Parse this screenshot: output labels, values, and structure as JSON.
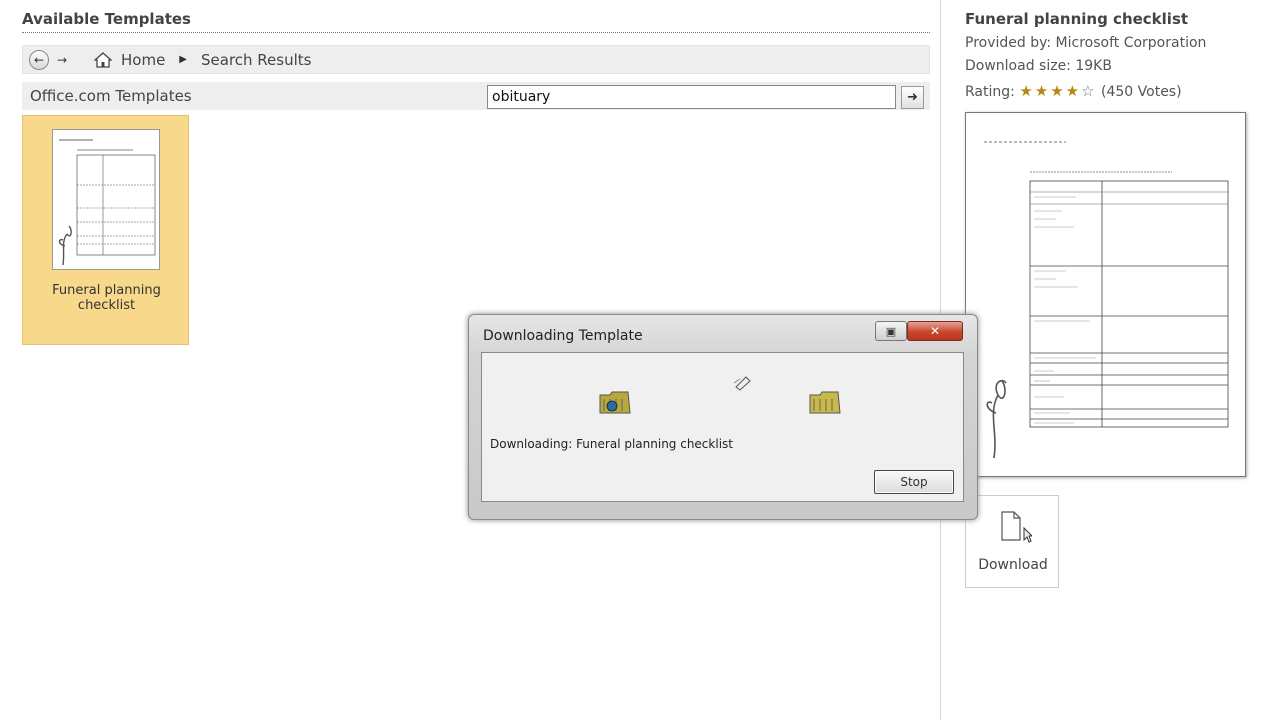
{
  "main": {
    "heading": "Available Templates",
    "breadcrumb": {
      "home": "Home",
      "current": "Search Results"
    },
    "source_label": "Office.com Templates",
    "search": {
      "value": "obituary"
    },
    "templates": [
      {
        "name": "Funeral planning checklist"
      }
    ]
  },
  "details": {
    "title": "Funeral planning checklist",
    "provided_by": "Provided by: Microsoft Corporation",
    "download_size": "Download size: 19KB",
    "rating_label": "Rating:",
    "rating_stars": 4,
    "votes": "(450 Votes)",
    "download_label": "Download"
  },
  "dialog": {
    "title": "Downloading Template",
    "status": "Downloading: Funeral planning checklist",
    "stop_label": "Stop"
  },
  "colors": {
    "selected_tile": "#f8d98c",
    "close_button": "#c8472f"
  }
}
